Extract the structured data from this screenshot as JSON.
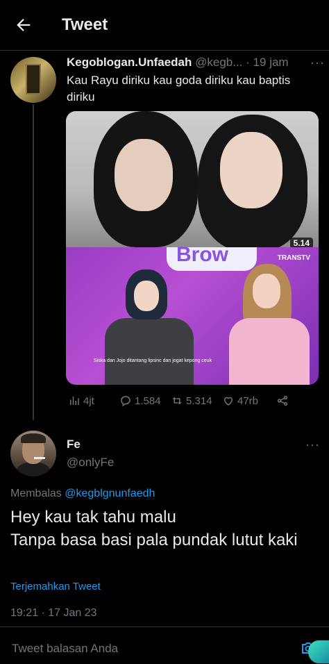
{
  "header": {
    "title": "Tweet"
  },
  "tweet": {
    "name": "Kegoblogan.Unfaedah",
    "handle": "@kegb...",
    "time": "· 19 jam",
    "text": "Kau Rayu diriku kau goda diriku kau baptis diriku",
    "media": {
      "duration": "5.14",
      "channel": "TRANSTV",
      "banner": "Brow",
      "subtitle": "Siska dan Jojo ditantang lipsinc dan jogat kepong ceuk"
    },
    "stats": {
      "views": "4jt",
      "replies": "1.584",
      "retweets": "5.314",
      "likes": "47rb"
    }
  },
  "reply": {
    "name": "Fe",
    "handle": "@onlyFe",
    "replying_label": "Membalas",
    "replying_to": "@kegblgnunfaedh",
    "text": "Hey kau tak tahu malu\nTanpa basa basi pala pundak lutut kaki",
    "translate": "Terjemahkan Tweet",
    "timestamp": "19:21 · 17 Jan 23"
  },
  "composer": {
    "placeholder": "Tweet balasan Anda"
  },
  "colors": {
    "background": "#000000",
    "accent": "#1d9bf0",
    "muted": "#71767b",
    "text": "#e7e9ea"
  },
  "icons": [
    "back-arrow-icon",
    "more-icon",
    "views-icon",
    "reply-icon",
    "retweet-icon",
    "like-icon",
    "share-icon",
    "camera-icon"
  ]
}
